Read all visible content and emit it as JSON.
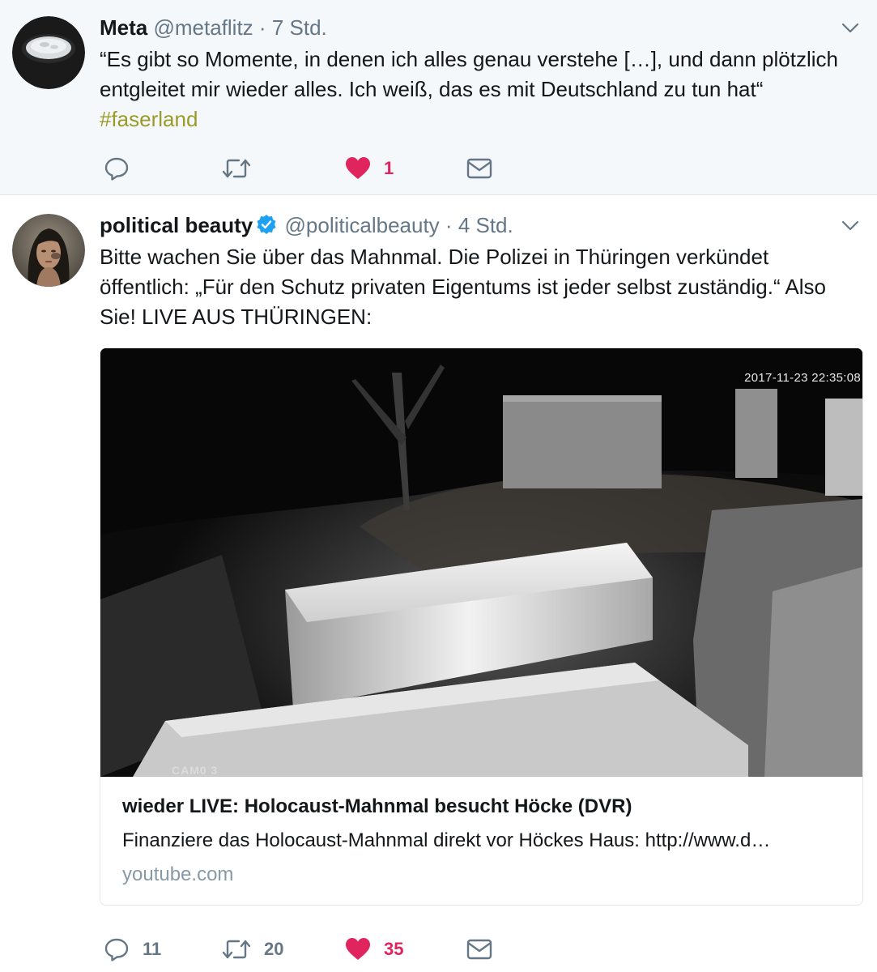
{
  "tweets": [
    {
      "author_name": "Meta",
      "handle": "@metaflitz",
      "separator": "·",
      "time": "7 Std.",
      "text": "“Es gibt so Momente, in denen ich alles genau verstehe […], und dann plötzlich entgleitet mir wieder alles. Ich weiß, das es mit Deutschland zu tun hat“",
      "hashtag": "#faserland",
      "likes": "1",
      "icons": [
        "reply-icon",
        "retweet-icon",
        "heart-icon",
        "message-icon",
        "chevron-down-icon"
      ]
    },
    {
      "author_name": "political beauty",
      "verified": true,
      "handle": "@politicalbeauty",
      "separator": "·",
      "time": "4 Std.",
      "text": "Bitte wachen Sie über das Mahnmal. Die Polizei in Thüringen verkündet öffentlich: „Für den Schutz privaten Eigentums ist jeder selbst zuständig.“ Also Sie! LIVE AUS THÜRINGEN:",
      "card": {
        "image_timestamp": "2017-11-23 22:35:08",
        "image_label": "CAM0 3",
        "title": "wieder LIVE: Holocaust-Mahnmal besucht Höcke (DVR)",
        "description": "Finanziere das Holocaust-Mahnmal direkt vor Höckes Haus: http://www.d…",
        "domain": "youtube.com"
      },
      "replies": "11",
      "retweets": "20",
      "likes": "35",
      "icons": [
        "reply-icon",
        "retweet-icon",
        "heart-icon",
        "message-icon",
        "chevron-down-icon",
        "verified-badge-icon"
      ]
    }
  ],
  "colors": {
    "hashtag": "#9a9b28",
    "like_red": "#e0245e",
    "secondary_text": "#657786",
    "icon_grey": "#657786",
    "verified_blue": "#1da1f2",
    "top_tweet_bg": "#f5f8fa"
  }
}
